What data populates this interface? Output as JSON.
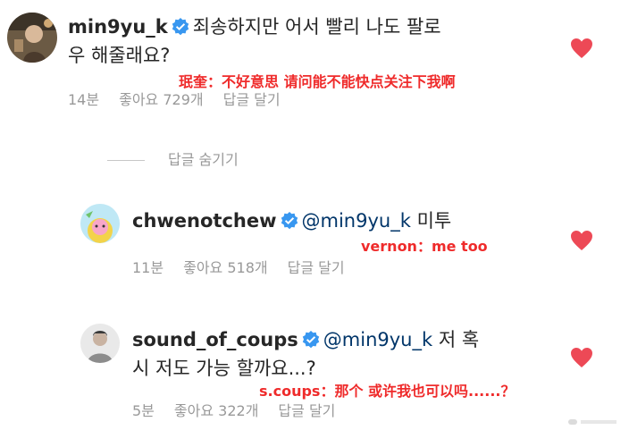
{
  "comments": [
    {
      "username": "min9yu_k",
      "verified": true,
      "mention": "",
      "text_line1": "죄송하지만 어서 빨리 나도 팔로",
      "text_line2": "우 해줄래요?",
      "translation": "珉奎：不好意思 请问能不能快点关注下我啊",
      "time": "14분",
      "likes": "좋아요 729개",
      "reply": "답글 달기",
      "liked": true
    },
    {
      "username": "chwenotchew",
      "verified": true,
      "mention": "@min9yu_k",
      "text_line1": "미투",
      "text_line2": "",
      "translation": "vernon：me too",
      "time": "11분",
      "likes": "좋아요 518개",
      "reply": "답글 달기",
      "liked": true
    },
    {
      "username": "sound_of_coups",
      "verified": true,
      "mention": "@min9yu_k",
      "text_line1": "저 혹",
      "text_line2": "시 저도 가능 할까요...?",
      "translation": "s.coups：那个 或许我也可以吗......？",
      "time": "5분",
      "likes": "좋아요 322개",
      "reply": "답글 달기",
      "liked": true
    }
  ],
  "hide_replies_label": "답글 숨기기",
  "colors": {
    "heart": "#ed4956",
    "verified": "#3897f0",
    "translation": "#ef2b2b",
    "meta": "#999999"
  },
  "icons": {
    "verified": "verified-badge-icon",
    "like": "heart-icon"
  }
}
